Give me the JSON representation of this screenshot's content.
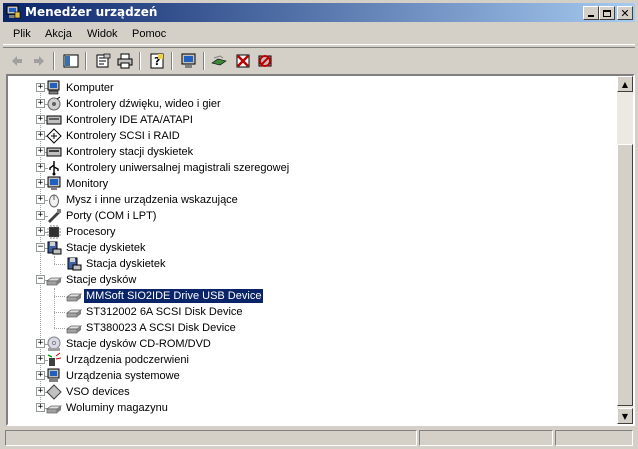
{
  "window": {
    "title": "Menedżer urządzeń"
  },
  "title_buttons": [
    "minimize-icon",
    "maximize-icon",
    "close-icon"
  ],
  "menu": [
    "Plik",
    "Akcja",
    "Widok",
    "Pomoc"
  ],
  "toolbar": {
    "icons": [
      "back-arrow-icon",
      "forward-arrow-icon",
      "show-hide-tree-icon",
      "properties-icon",
      "print-icon",
      "help-icon",
      "scan-hardware-icon",
      "update-driver-icon",
      "disable-device-icon",
      "uninstall-device-icon"
    ]
  },
  "tree": {
    "items": [
      {
        "label": "Komputer",
        "level": 0,
        "expanded": false,
        "icon": "computer-icon"
      },
      {
        "label": "Kontrolery dźwięku, wideo i gier",
        "level": 0,
        "expanded": false,
        "icon": "sound-icon"
      },
      {
        "label": "Kontrolery IDE ATA/ATAPI",
        "level": 0,
        "expanded": false,
        "icon": "ide-controller-icon"
      },
      {
        "label": "Kontrolery SCSI i RAID",
        "level": 0,
        "expanded": false,
        "icon": "scsi-controller-icon"
      },
      {
        "label": "Kontrolery stacji dyskietek",
        "level": 0,
        "expanded": false,
        "icon": "floppy-controller-icon"
      },
      {
        "label": "Kontrolery uniwersalnej magistrali szeregowej",
        "level": 0,
        "expanded": false,
        "icon": "usb-icon"
      },
      {
        "label": "Monitory",
        "level": 0,
        "expanded": false,
        "icon": "monitor-icon"
      },
      {
        "label": "Mysz i inne urządzenia wskazujące",
        "level": 0,
        "expanded": false,
        "icon": "mouse-icon"
      },
      {
        "label": "Porty (COM i LPT)",
        "level": 0,
        "expanded": false,
        "icon": "port-icon"
      },
      {
        "label": "Procesory",
        "level": 0,
        "expanded": false,
        "icon": "processor-icon"
      },
      {
        "label": "Stacje dyskietek",
        "level": 0,
        "expanded": true,
        "icon": "floppy-drive-icon"
      },
      {
        "label": "Stacja dyskietek",
        "level": 1,
        "icon": "floppy-drive-icon"
      },
      {
        "label": "Stacje dysków",
        "level": 0,
        "expanded": true,
        "icon": "disk-drive-icon"
      },
      {
        "label": "MMSoft SIO2IDE Drive USB Device",
        "level": 1,
        "icon": "disk-drive-icon",
        "selected": true
      },
      {
        "label": "ST312002 6A SCSI Disk Device",
        "level": 1,
        "icon": "disk-drive-icon"
      },
      {
        "label": "ST380023 A SCSI Disk Device",
        "level": 1,
        "icon": "disk-drive-icon"
      },
      {
        "label": "Stacje dysków CD-ROM/DVD",
        "level": 0,
        "expanded": false,
        "icon": "cdrom-icon"
      },
      {
        "label": "Urządzenia podczerwieni",
        "level": 0,
        "expanded": false,
        "icon": "infrared-icon"
      },
      {
        "label": "Urządzenia systemowe",
        "level": 0,
        "expanded": false,
        "icon": "system-device-icon"
      },
      {
        "label": "VSO devices",
        "level": 0,
        "expanded": false,
        "icon": "vso-device-icon"
      },
      {
        "label": "Woluminy magazynu",
        "level": 0,
        "expanded": false,
        "icon": "storage-volume-icon"
      }
    ]
  },
  "colors": {
    "titlebar_start": "#0a246a",
    "titlebar_end": "#a6caf0",
    "selection": "#0a246a",
    "face": "#d4d0c8"
  }
}
